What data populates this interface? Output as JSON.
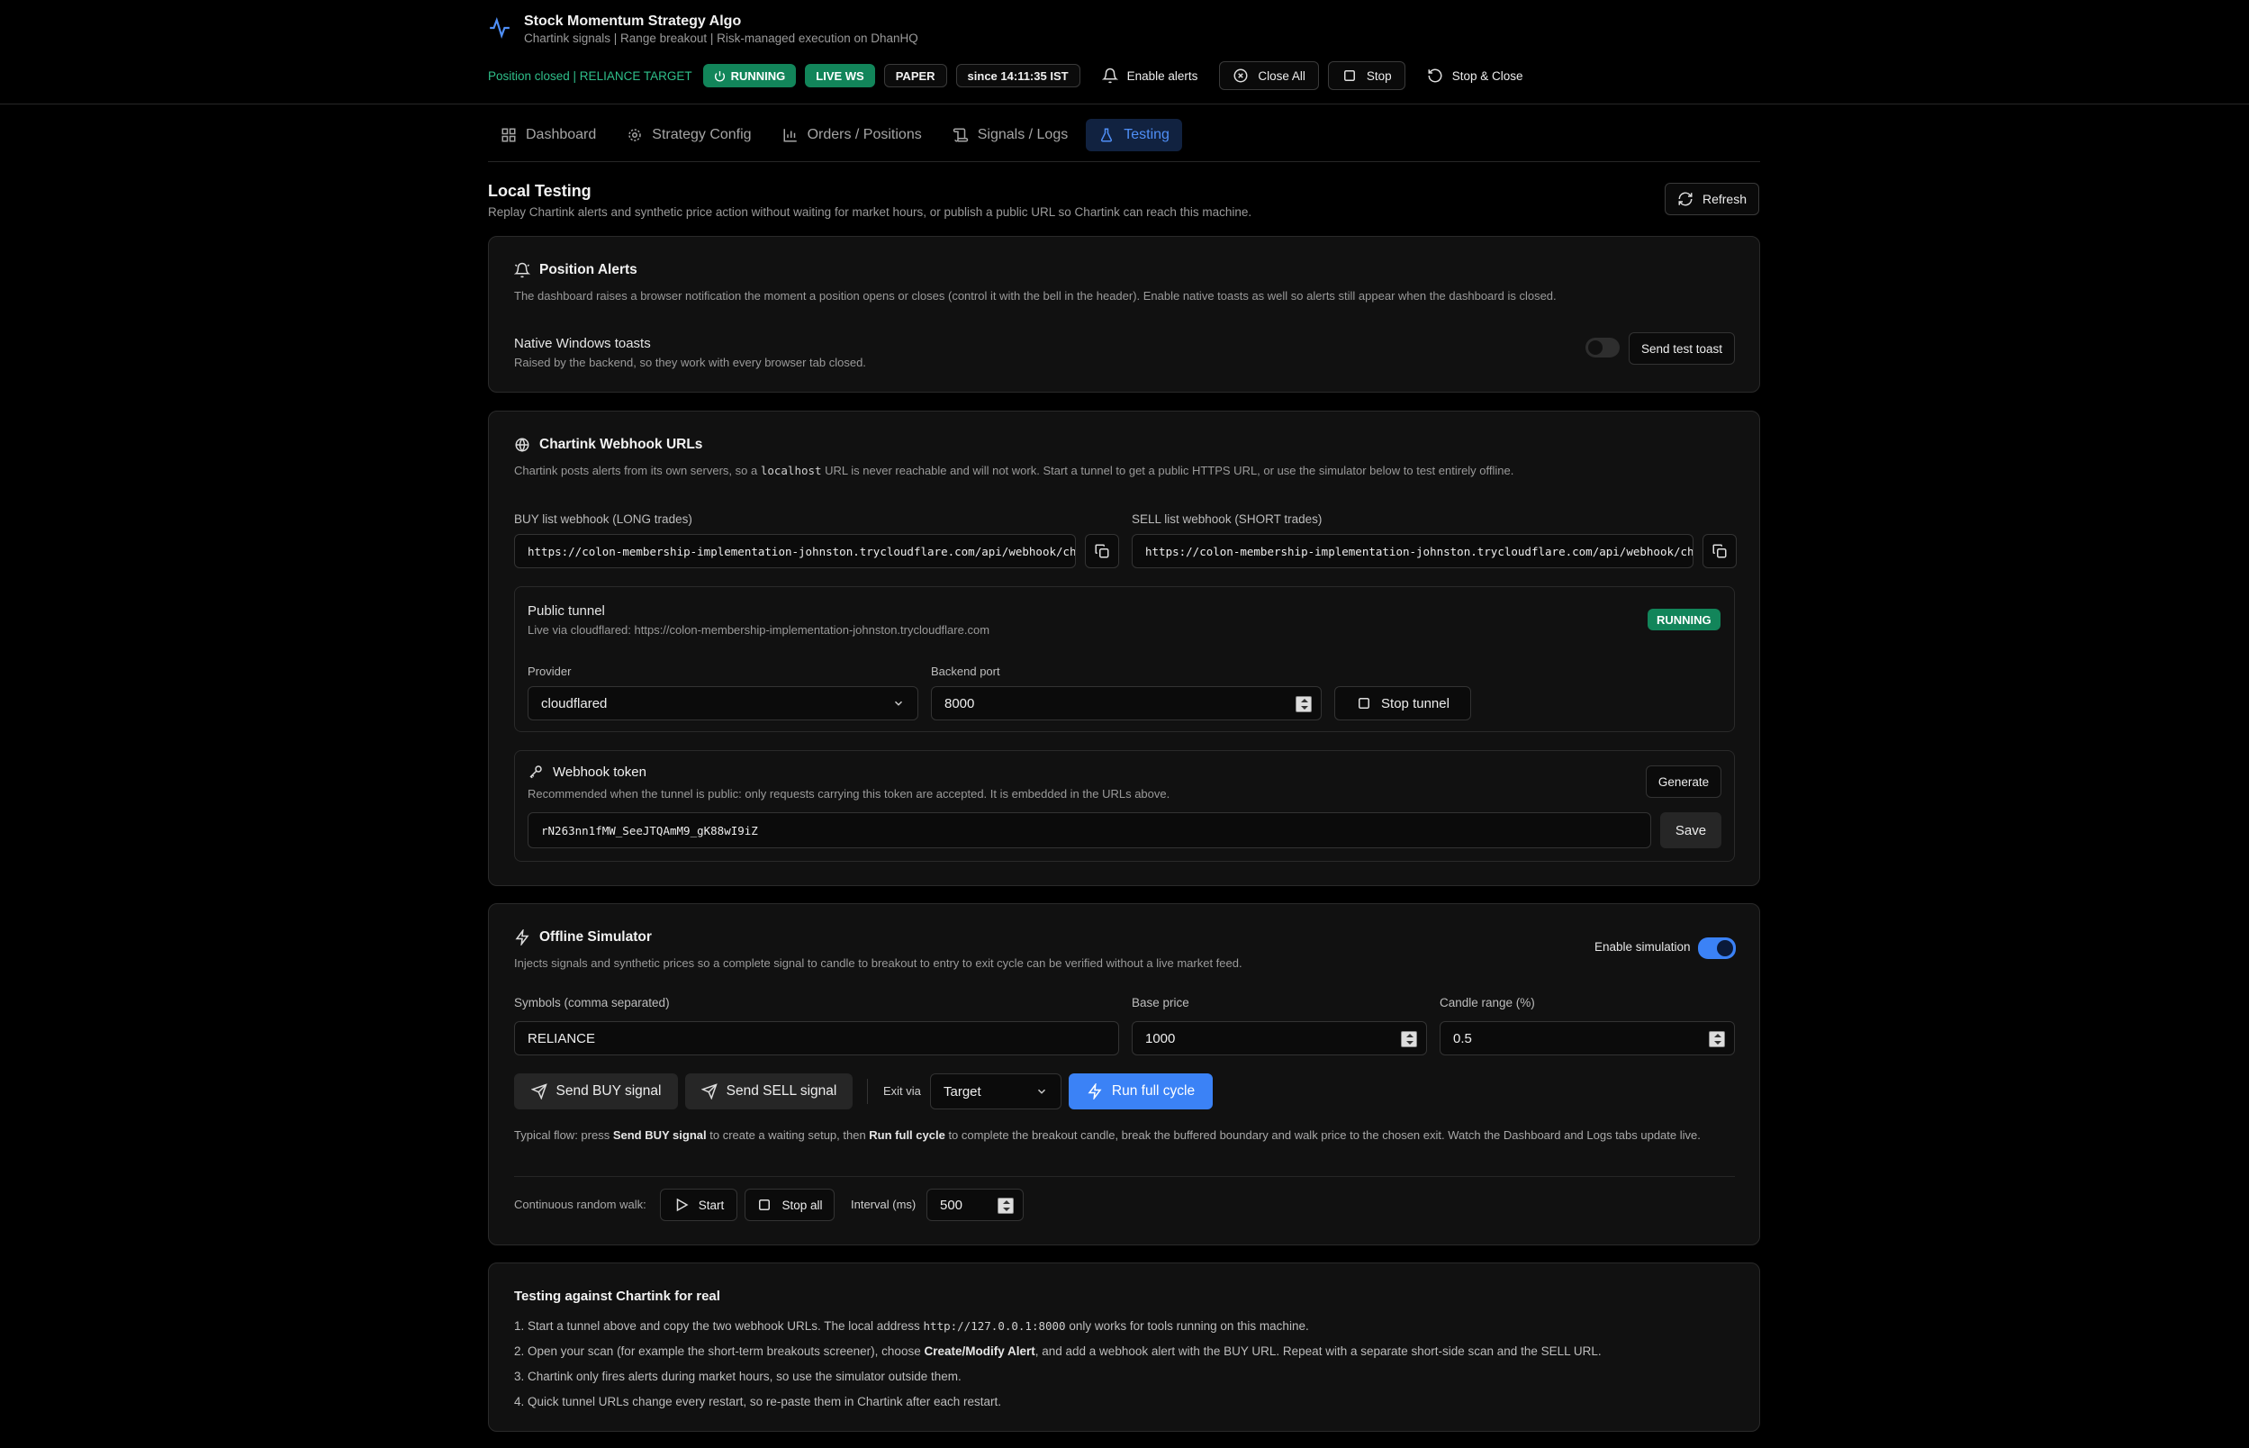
{
  "app": {
    "title": "Stock Momentum Strategy Algo",
    "subtitle": "Chartink signals | Range breakout | Risk-managed execution on DhanHQ"
  },
  "status": {
    "text": "Position closed | RELIANCE TARGET",
    "running": "RUNNING",
    "live_ws": "LIVE WS",
    "mode": "PAPER",
    "since": "since 14:11:35 IST"
  },
  "header_actions": {
    "enable_alerts": "Enable alerts",
    "close_all": "Close All",
    "stop": "Stop",
    "stop_close": "Stop & Close"
  },
  "tabs": [
    {
      "label": "Dashboard",
      "icon": "grid-icon"
    },
    {
      "label": "Strategy Config",
      "icon": "gear-icon"
    },
    {
      "label": "Orders / Positions",
      "icon": "chart-icon"
    },
    {
      "label": "Signals / Logs",
      "icon": "scroll-icon"
    },
    {
      "label": "Testing",
      "icon": "flask-icon",
      "active": true
    }
  ],
  "page": {
    "title": "Local Testing",
    "subtitle": "Replay Chartink alerts and synthetic price action without waiting for market hours, or publish a public URL so Chartink can reach this machine.",
    "refresh": "Refresh"
  },
  "alerts": {
    "title": "Position Alerts",
    "desc": "The dashboard raises a browser notification the moment a position opens or closes (control it with the bell in the header). Enable native toasts as well so alerts still appear when the dashboard is closed.",
    "native_label": "Native Windows toasts",
    "native_desc": "Raised by the backend, so they work with every browser tab closed.",
    "native_enabled": false,
    "send_test": "Send test toast"
  },
  "webhooks": {
    "title": "Chartink Webhook URLs",
    "desc_a": "Chartink posts alerts from its own servers, so a ",
    "desc_code": "localhost",
    "desc_b": " URL is never reachable and will not work. Start a tunnel to get a public HTTPS URL, or use the simulator below to test entirely offline.",
    "buy_label": "BUY list webhook (LONG trades)",
    "buy_url": "https://colon-membership-implementation-johnston.trycloudflare.com/api/webhook/chartink/long?token=rN263nn1fMW_SeeJTQAmM9_gK88wI9iZ",
    "sell_label": "SELL list webhook (SHORT trades)",
    "sell_url": "https://colon-membership-implementation-johnston.trycloudflare.com/api/webhook/chartink/short?token=rN263nn1fMW_SeeJTQAmM9_gK88wI9iZ",
    "tunnel": {
      "title": "Public tunnel",
      "status_text": "Live via cloudflared: https://colon-membership-implementation-johnston.trycloudflare.com",
      "badge": "RUNNING",
      "provider_label": "Provider",
      "provider_value": "cloudflared",
      "port_label": "Backend port",
      "port_value": "8000",
      "stop": "Stop tunnel"
    },
    "token": {
      "title": "Webhook token",
      "desc": "Recommended when the tunnel is public: only requests carrying this token are accepted. It is embedded in the URLs above.",
      "generate": "Generate",
      "value": "rN263nn1fMW_SeeJTQAmM9_gK88wI9iZ",
      "save": "Save"
    }
  },
  "simulator": {
    "title": "Offline Simulator",
    "desc": "Injects signals and synthetic prices so a complete signal to candle to breakout to entry to exit cycle can be verified without a live market feed.",
    "enable_label": "Enable simulation",
    "enabled": true,
    "symbols_label": "Symbols (comma separated)",
    "symbols_value": "RELIANCE",
    "base_label": "Base price",
    "base_value": "1000",
    "range_label": "Candle range (%)",
    "range_value": "0.5",
    "send_buy": "Send BUY signal",
    "send_sell": "Send SELL signal",
    "exit_label": "Exit via",
    "exit_value": "Target",
    "run_full": "Run full cycle",
    "flow_a": "Typical flow: press ",
    "flow_b": "Send BUY signal",
    "flow_c": " to create a waiting setup, then ",
    "flow_d": "Run full cycle",
    "flow_e": " to complete the breakout candle, break the buffered boundary and walk price to the chosen exit. Watch the Dashboard and Logs tabs update live.",
    "walk_label": "Continuous random walk:",
    "start": "Start",
    "stop_all": "Stop all",
    "interval_label": "Interval (ms)",
    "interval_value": "500"
  },
  "guide": {
    "title": "Testing against Chartink for real",
    "s1a": "1. Start a tunnel above and copy the two webhook URLs. The local address ",
    "s1code": "http://127.0.0.1:8000",
    "s1b": " only works for tools running on this machine.",
    "s2a": "2. Open your scan (for example the short-term breakouts screener), choose ",
    "s2b": "Create/Modify Alert",
    "s2c": ", and add a webhook alert with the BUY URL. Repeat with a separate short-side scan and the SELL URL.",
    "s3": "3. Chartink only fires alerts during market hours, so use the simulator outside them.",
    "s4": "4. Quick tunnel URLs change every restart, so re-paste them in Chartink after each restart."
  },
  "colors": {
    "accent": "#3b82f6",
    "success": "#12855a",
    "background": "#000000",
    "card": "#111111"
  }
}
